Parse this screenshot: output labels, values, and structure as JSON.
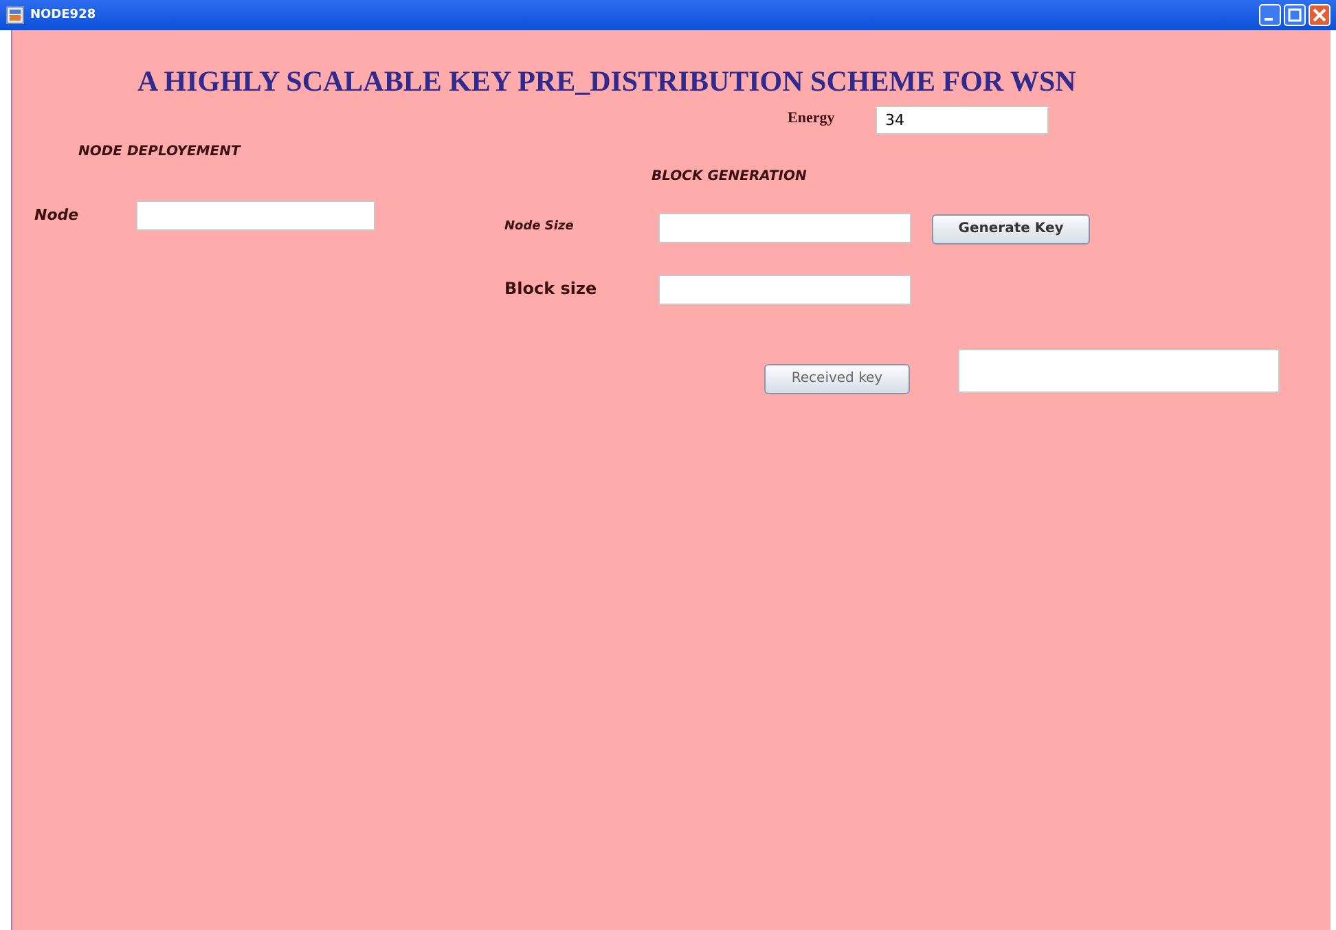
{
  "window": {
    "title": "NODE928"
  },
  "heading": "A HIGHLY SCALABLE KEY PRE_DISTRIBUTION SCHEME FOR WSN",
  "energy": {
    "label": "Energy",
    "value": "34"
  },
  "node_deployment": {
    "title": "NODE DEPLOYEMENT",
    "node_label": "Node"
  },
  "block_generation": {
    "title": "BLOCK GENERATION",
    "node_size_label": "Node Size",
    "block_size_label": "Block size",
    "generate_button": "Generate Key"
  },
  "received": {
    "button": "Received key"
  }
}
